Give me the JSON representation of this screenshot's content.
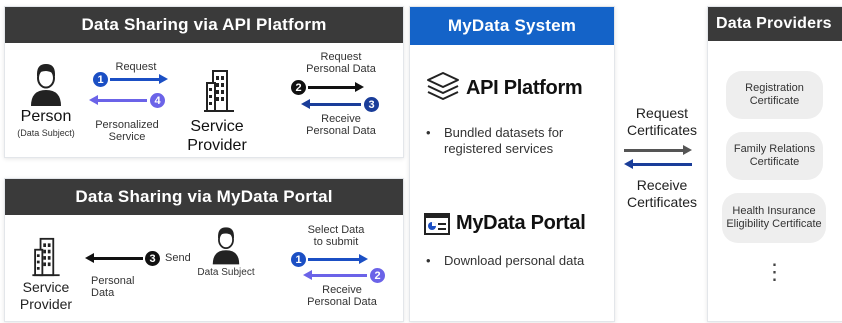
{
  "api_sharing": {
    "title": "Data Sharing via API Platform",
    "person_label": "Person",
    "person_sub": "(Data Subject)",
    "request_label": "Request",
    "personalized_service_label": "Personalized\nService",
    "service_provider_label": "Service\nProvider",
    "request_personal_data_label": "Request\nPersonal Data",
    "receive_personal_data_label": "Receive\nPersonal Data",
    "steps": [
      "1",
      "2",
      "3",
      "4"
    ]
  },
  "portal_sharing": {
    "title": "Data Sharing via MyData Portal",
    "service_provider_label": "Service\nProvider",
    "send_label": "Send",
    "personal_data_label": "Personal\nData",
    "data_subject_label": "Data Subject",
    "select_data_label": "Select Data\nto submit",
    "receive_personal_data_label": "Receive\nPersonal Data",
    "steps": [
      "1",
      "2",
      "3"
    ]
  },
  "mydata_system": {
    "title": "MyData System",
    "api_platform_label": "API Platform",
    "api_platform_bullet": "Bundled datasets for\nregistered services",
    "portal_label": "MyData Portal",
    "portal_bullet": "Download personal data"
  },
  "exchange": {
    "request_label": "Request\nCertificates",
    "receive_label": "Receive\nCertificates"
  },
  "providers": {
    "title": "Data Providers",
    "items": [
      "Registration\nCertificate",
      "Family Relations\nCertificate",
      "Health Insurance\nEligibility Certificate"
    ],
    "more": "⋮"
  },
  "colors": {
    "dark_header": "#3a3a3a",
    "blue_header": "#1463c8",
    "step_blue": "#1b4fc4",
    "step_purple": "#6b63e8"
  }
}
